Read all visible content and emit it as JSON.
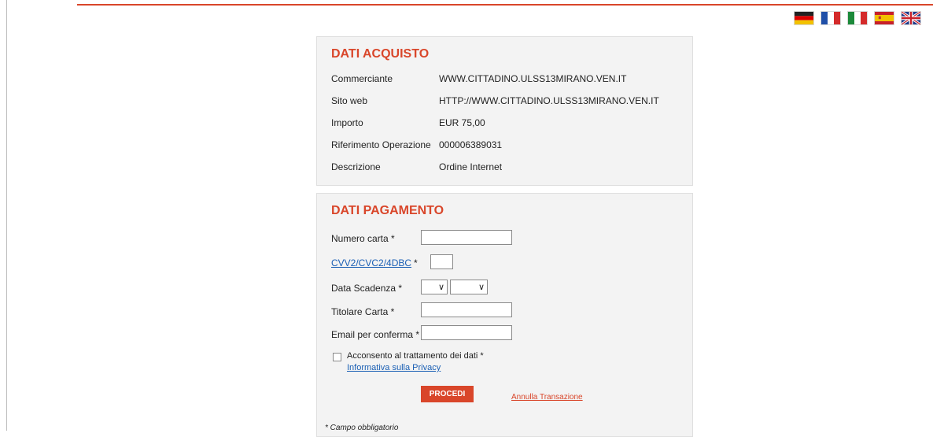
{
  "languages": [
    {
      "code": "de",
      "icon": "german-flag-icon"
    },
    {
      "code": "fr",
      "icon": "french-flag-icon"
    },
    {
      "code": "it",
      "icon": "italian-flag-icon"
    },
    {
      "code": "es",
      "icon": "spanish-flag-icon"
    },
    {
      "code": "en",
      "icon": "uk-flag-icon"
    }
  ],
  "colors": {
    "accent": "#d9462a",
    "link": "#1a5fb4",
    "panel_bg": "#f3f3f3"
  },
  "acquisto": {
    "title": "DATI ACQUISTO",
    "rows": [
      {
        "label": "Commerciante",
        "value": "WWW.CITTADINO.ULSS13MIRANO.VEN.IT"
      },
      {
        "label": "Sito web",
        "value": "HTTP://WWW.CITTADINO.ULSS13MIRANO.VEN.IT"
      },
      {
        "label": "Importo",
        "value": "EUR 75,00"
      },
      {
        "label": "Riferimento Operazione",
        "value": "000006389031"
      },
      {
        "label": "Descrizione",
        "value": "Ordine Internet"
      }
    ]
  },
  "pagamento": {
    "title": "DATI PAGAMENTO",
    "numero_carta_label": "Numero carta *",
    "cvv_link": "CVV2/CVC2/4DBC",
    "cvv_req": "*",
    "scadenza_label": "Data Scadenza *",
    "titolare_label": "Titolare Carta *",
    "email_label": "Email per conferma *",
    "consent_label": "Acconsento al trattamento dei dati *",
    "privacy_link": "Informativa sulla Privacy",
    "procedi_label": "PROCEDI",
    "annulla_label": "Annulla Transazione",
    "footnote": "* Campo obbligatorio"
  }
}
